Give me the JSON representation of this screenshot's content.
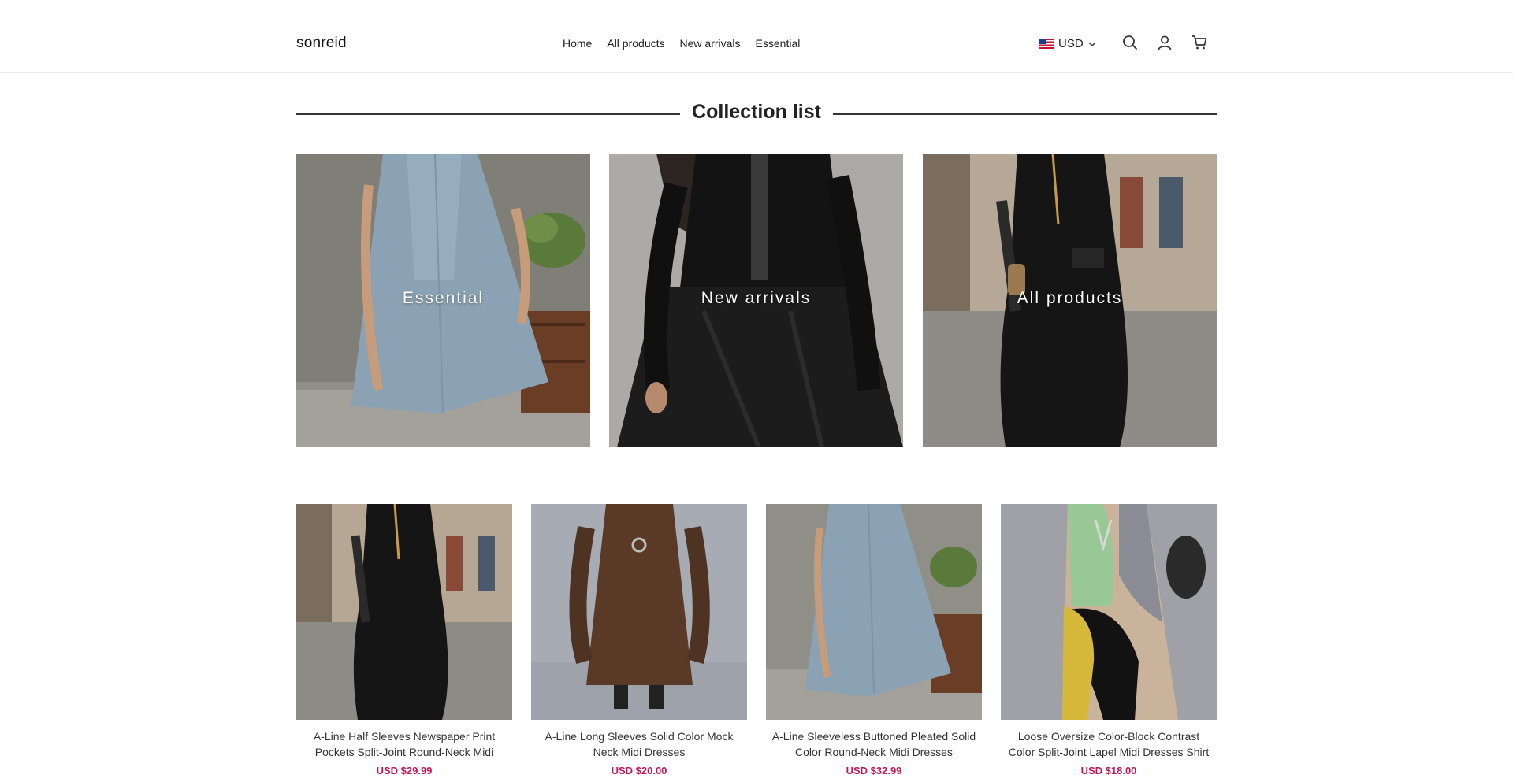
{
  "header": {
    "logo": "sonreid",
    "nav": [
      "Home",
      "All products",
      "New arrivals",
      "Essential"
    ],
    "currency": "USD",
    "icons": [
      "search-icon",
      "account-icon",
      "cart-icon"
    ]
  },
  "collection_section": {
    "title": "Collection list",
    "collections": [
      {
        "label": "Essential"
      },
      {
        "label": "New arrivals"
      },
      {
        "label": "All products"
      }
    ]
  },
  "products": [
    {
      "name": "A-Line Half Sleeves Newspaper Print Pockets Split-Joint Round-Neck Midi Dresses",
      "price": "USD $29.99"
    },
    {
      "name": "A-Line Long Sleeves Solid Color Mock Neck Midi Dresses",
      "price": "USD $20.00"
    },
    {
      "name": "A-Line Sleeveless Buttoned Pleated Solid Color Round-Neck Midi Dresses",
      "price": "USD $32.99"
    },
    {
      "name": "Loose Oversize Color-Block Contrast Color Split-Joint Lapel Midi Dresses Shirt Dresses",
      "price": "USD $18.00"
    }
  ],
  "colors": {
    "price": "#c2185b",
    "text": "#222222",
    "border": "#ececec"
  }
}
